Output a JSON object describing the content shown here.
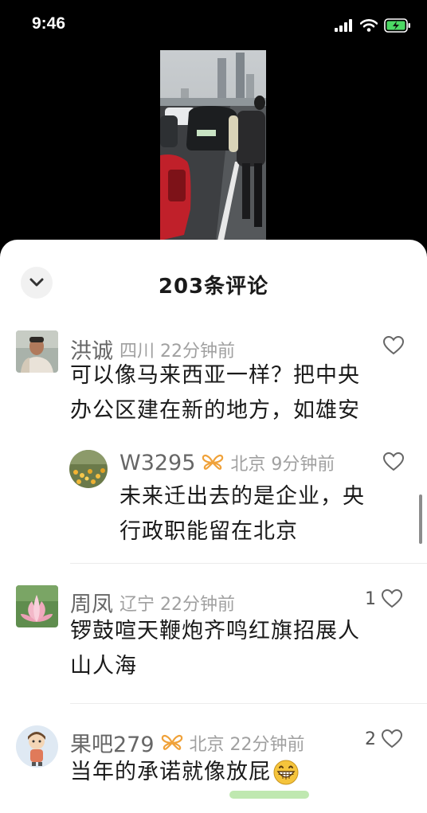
{
  "status_bar": {
    "time": "9:46"
  },
  "header": {
    "title": "203条评论"
  },
  "comments": [
    {
      "name": "洪诚",
      "meta": "四川 22分钟前",
      "text": "可以像马来西亚一样？把中央办公区建在新的地方，如雄安",
      "text_line1": "可以像马来西亚一样？把中央",
      "text_line2": "办公区建在新的地方，如雄安",
      "likes": ""
    },
    {
      "name": "W3295",
      "meta": "北京 9分钟前",
      "text": "未来迁出去的是企业，央行政职能留在北京",
      "text_line1": "未来迁出去的是企业，央",
      "text_line2": "行政职能留在北京",
      "likes": ""
    },
    {
      "name": "周凤",
      "meta": "辽宁 22分钟前",
      "text": "锣鼓喧天鞭炮齐鸣红旗招展人山人海",
      "text_line1": "锣鼓喧天鞭炮齐鸣红旗招展人",
      "text_line2": "山人海",
      "likes": "1"
    },
    {
      "name": "果吧279",
      "meta": "北京 22分钟前",
      "text": "当年的承诺就像放屁😁",
      "text_line1": "当年的承诺就像放屁",
      "likes": "2"
    }
  ],
  "icons": {
    "collapse": "chevron-down-icon",
    "like": "heart-outline-icon",
    "badge": "butterfly-badge-icon",
    "emoji": "grinning-emoji-icon"
  },
  "colors": {
    "badge": "#f0a23a",
    "emoji": "#f5c43c"
  }
}
